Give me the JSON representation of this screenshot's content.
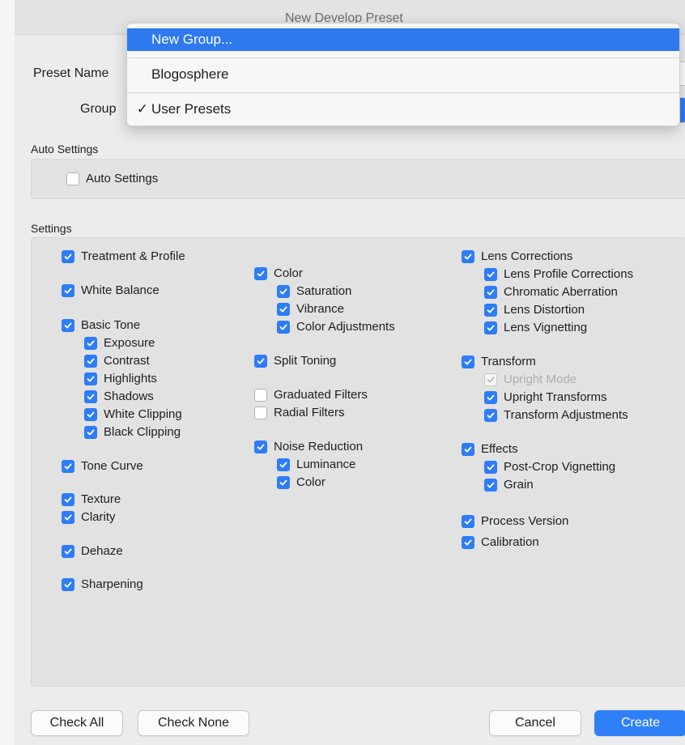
{
  "dialog": {
    "title": "New Develop Preset",
    "preset_name_label": "Preset Name",
    "group_label": "Group"
  },
  "dropdown": {
    "items": [
      {
        "label": "New Group...",
        "checked": false,
        "highlighted": true
      },
      {
        "label": "Blogosphere",
        "checked": false,
        "highlighted": false
      },
      {
        "label": "User Presets",
        "checked": true,
        "highlighted": false
      }
    ],
    "checkmark": "✓"
  },
  "auto_settings": {
    "section_label": "Auto Settings",
    "checkbox": {
      "label": "Auto Settings",
      "checked": false
    }
  },
  "settings": {
    "section_label": "Settings",
    "col1": [
      {
        "label": "Treatment & Profile",
        "state": "on"
      },
      {
        "label": "White Balance",
        "state": "on"
      },
      {
        "label": "Basic Tone",
        "state": "on"
      },
      {
        "label": "Exposure",
        "state": "on"
      },
      {
        "label": "Contrast",
        "state": "on"
      },
      {
        "label": "Highlights",
        "state": "on"
      },
      {
        "label": "Shadows",
        "state": "on"
      },
      {
        "label": "White Clipping",
        "state": "on"
      },
      {
        "label": "Black Clipping",
        "state": "on"
      },
      {
        "label": "Tone Curve",
        "state": "on"
      },
      {
        "label": "Texture",
        "state": "on"
      },
      {
        "label": "Clarity",
        "state": "on"
      },
      {
        "label": "Dehaze",
        "state": "on"
      },
      {
        "label": "Sharpening",
        "state": "on"
      }
    ],
    "col2": [
      {
        "label": "Color",
        "state": "on"
      },
      {
        "label": "Saturation",
        "state": "on"
      },
      {
        "label": "Vibrance",
        "state": "on"
      },
      {
        "label": "Color Adjustments",
        "state": "on"
      },
      {
        "label": "Split Toning",
        "state": "on"
      },
      {
        "label": "Graduated Filters",
        "state": "off"
      },
      {
        "label": "Radial Filters",
        "state": "off"
      },
      {
        "label": "Noise Reduction",
        "state": "on"
      },
      {
        "label": "Luminance",
        "state": "on"
      },
      {
        "label": "Color",
        "state": "on"
      }
    ],
    "col3": [
      {
        "label": "Lens Corrections",
        "state": "on"
      },
      {
        "label": "Lens Profile Corrections",
        "state": "on"
      },
      {
        "label": "Chromatic Aberration",
        "state": "on"
      },
      {
        "label": "Lens Distortion",
        "state": "on"
      },
      {
        "label": "Lens Vignetting",
        "state": "on"
      },
      {
        "label": "Transform",
        "state": "on"
      },
      {
        "label": "Upright Mode",
        "state": "disabled"
      },
      {
        "label": "Upright Transforms",
        "state": "on"
      },
      {
        "label": "Transform Adjustments",
        "state": "on"
      },
      {
        "label": "Effects",
        "state": "on"
      },
      {
        "label": "Post-Crop Vignetting",
        "state": "on"
      },
      {
        "label": "Grain",
        "state": "on"
      },
      {
        "label": "Process Version",
        "state": "on"
      },
      {
        "label": "Calibration",
        "state": "on"
      }
    ]
  },
  "buttons": {
    "check_all": "Check All",
    "check_none": "Check None",
    "cancel": "Cancel",
    "create": "Create"
  },
  "colors": {
    "accent": "#2e7cf6",
    "menu_highlight": "#2e79ee"
  }
}
